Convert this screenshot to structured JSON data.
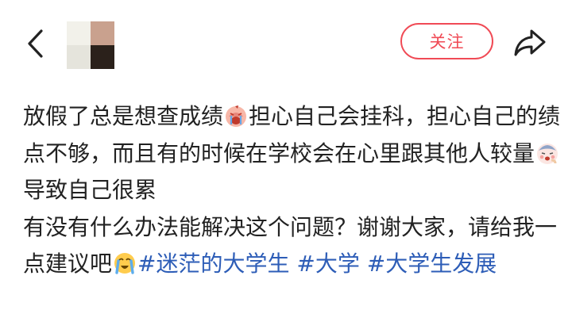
{
  "header": {
    "follow_label": "关注",
    "back_icon": "chevron-left-icon",
    "share_icon": "share-arrow-icon",
    "avatar_colors": [
      "#f2f1ea",
      "#c9a18e",
      "#e5e4dc",
      "#2b211b"
    ]
  },
  "post": {
    "line1_text1": "放假了总是想查成绩",
    "line1_text2": "担心自己会挂科，担心自己的绩点不够，而且有的时候在学校会在心里跟其他人较量",
    "line1_text3": "导致自己很累",
    "line2_text1": "有没有什么办法能解决这个问题？谢谢大家，请给我一点建议吧",
    "hashtags": [
      "#迷茫的大学生",
      "#大学",
      "#大学生发展"
    ],
    "emojis": [
      "crying-face-emoji",
      "tired-face-emoji",
      "loudly-crying-face-emoji"
    ]
  },
  "colors": {
    "accent": "#f04a55",
    "hashtag": "#2d5db7",
    "text": "#222222"
  }
}
